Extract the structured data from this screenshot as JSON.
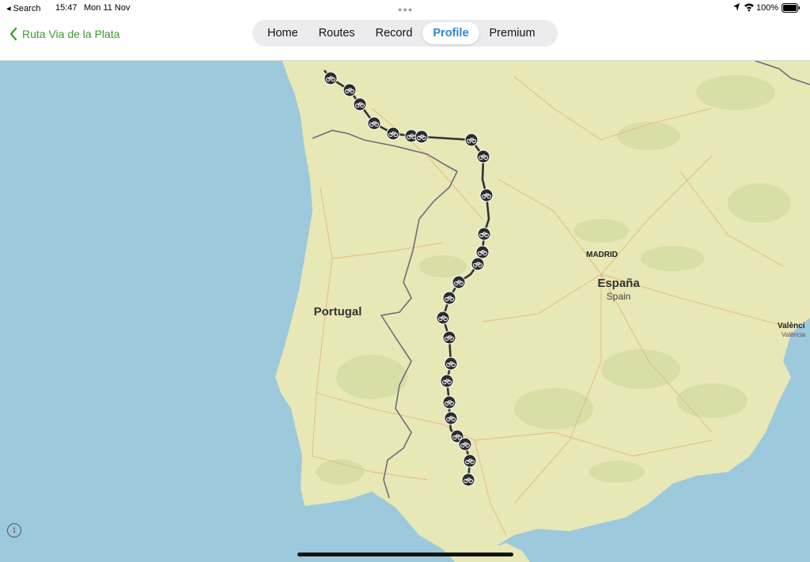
{
  "status_bar": {
    "back_app": "◂ Search",
    "time": "15:47",
    "date": "Mon 11 Nov",
    "battery": "100%"
  },
  "nav": {
    "back_label": "Ruta Via de la Plata",
    "tabs": [
      {
        "label": "Home"
      },
      {
        "label": "Routes"
      },
      {
        "label": "Record"
      },
      {
        "label": "Profile",
        "active": true
      },
      {
        "label": "Premium"
      }
    ]
  },
  "map": {
    "labels": {
      "madrid": "MADRID",
      "espana": "España",
      "spain": "Spain",
      "portugal": "Portugal",
      "valencia": "Valènci",
      "valencia_sub": "València"
    },
    "info_glyph": "i",
    "colors": {
      "sea": "#9cc9dc",
      "land": "#e8e7b6",
      "route": "#333333",
      "marker": "#2b2b2b"
    },
    "marker_icon": "bicycle-icon"
  }
}
